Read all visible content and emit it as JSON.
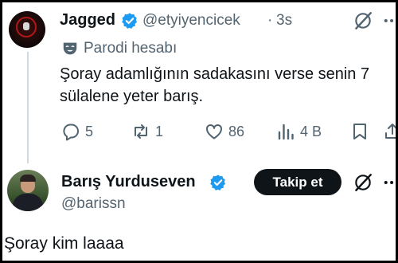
{
  "tweet": {
    "display_name": "Jagged",
    "handle": "@etyiyencicek",
    "separator": "·",
    "time": "3s",
    "parody_label": "Parodi hesabı",
    "text_line1": "Şoray adamlığının sadakasını verse senin 7",
    "text_line2": "sülalene yeter barış.",
    "actions": {
      "replies": "5",
      "reposts": "1",
      "likes": "86",
      "views": "4 B"
    }
  },
  "profile": {
    "display_name": "Barış Yurduseven",
    "handle": "@barissn",
    "follow_label": "Takip et",
    "bio": "Şoray kim laaaa"
  },
  "colors": {
    "verified_blue": "#1d9bf0",
    "muted_text": "#536471",
    "follow_button_bg": "#0f1419"
  },
  "icons": [
    "grok-icon",
    "more-icon",
    "parody-mask-icon",
    "reply-icon",
    "repost-icon",
    "like-icon",
    "views-icon",
    "bookmark-icon",
    "share-icon",
    "verified-badge-icon"
  ]
}
